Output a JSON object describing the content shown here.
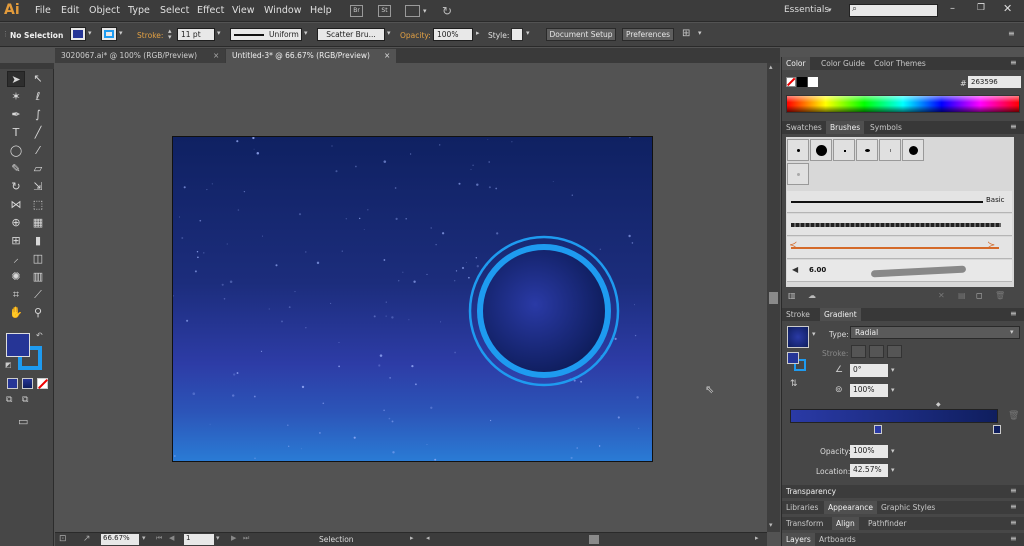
{
  "app": {
    "logo": "Ai"
  },
  "menu": {
    "items": [
      "File",
      "Edit",
      "Object",
      "Type",
      "Select",
      "Effect",
      "View",
      "Window",
      "Help"
    ],
    "bridge_icon": "Br",
    "stock_icon": "St"
  },
  "workspace": {
    "label": "Essentials",
    "search_placeholder": ""
  },
  "control": {
    "selection": "No Selection",
    "stroke_label": "Stroke:",
    "stroke_value": "11 pt",
    "profile": "Uniform",
    "brush": "Scatter Bru...",
    "opacity_label": "Opacity:",
    "opacity_value": "100%",
    "style_label": "Style:",
    "doc_setup": "Document Setup",
    "preferences": "Preferences"
  },
  "tabs": [
    {
      "label": "3020067.ai* @ 100% (RGB/Preview)",
      "active": false
    },
    {
      "label": "Untitled-3* @ 66.67% (RGB/Preview)",
      "active": true
    }
  ],
  "status": {
    "zoom": "66.67%",
    "page": "1",
    "tool": "Selection"
  },
  "color_panel": {
    "tabs": [
      "Color",
      "Color Guide",
      "Color Themes"
    ],
    "hex_label": "#",
    "hex": "263596"
  },
  "brush_panel": {
    "tabs": [
      "Swatches",
      "Brushes",
      "Symbols"
    ],
    "basic_label": "Basic",
    "size_value": "6.00"
  },
  "gradient_panel": {
    "tabs": [
      "Stroke",
      "Gradient"
    ],
    "type_label": "Type:",
    "type_value": "Radial",
    "stroke_label": "Stroke:",
    "angle_value": "0°",
    "aspect_value": "100%",
    "opacity_label": "Opacity:",
    "opacity_value": "100%",
    "location_label": "Location:",
    "location_value": "42.57%",
    "start_color": "#2a3aa6",
    "end_color": "#0f1e5e"
  },
  "collapsed_panels": {
    "transparency": "Transparency",
    "row1": [
      "Libraries",
      "Appearance",
      "Graphic Styles"
    ],
    "row2": [
      "Transform",
      "Align",
      "Pathfinder"
    ],
    "row3": [
      "Layers",
      "Artboards"
    ]
  },
  "colors": {
    "accent_ring": "#1e9bf0",
    "fill": "#263596"
  }
}
